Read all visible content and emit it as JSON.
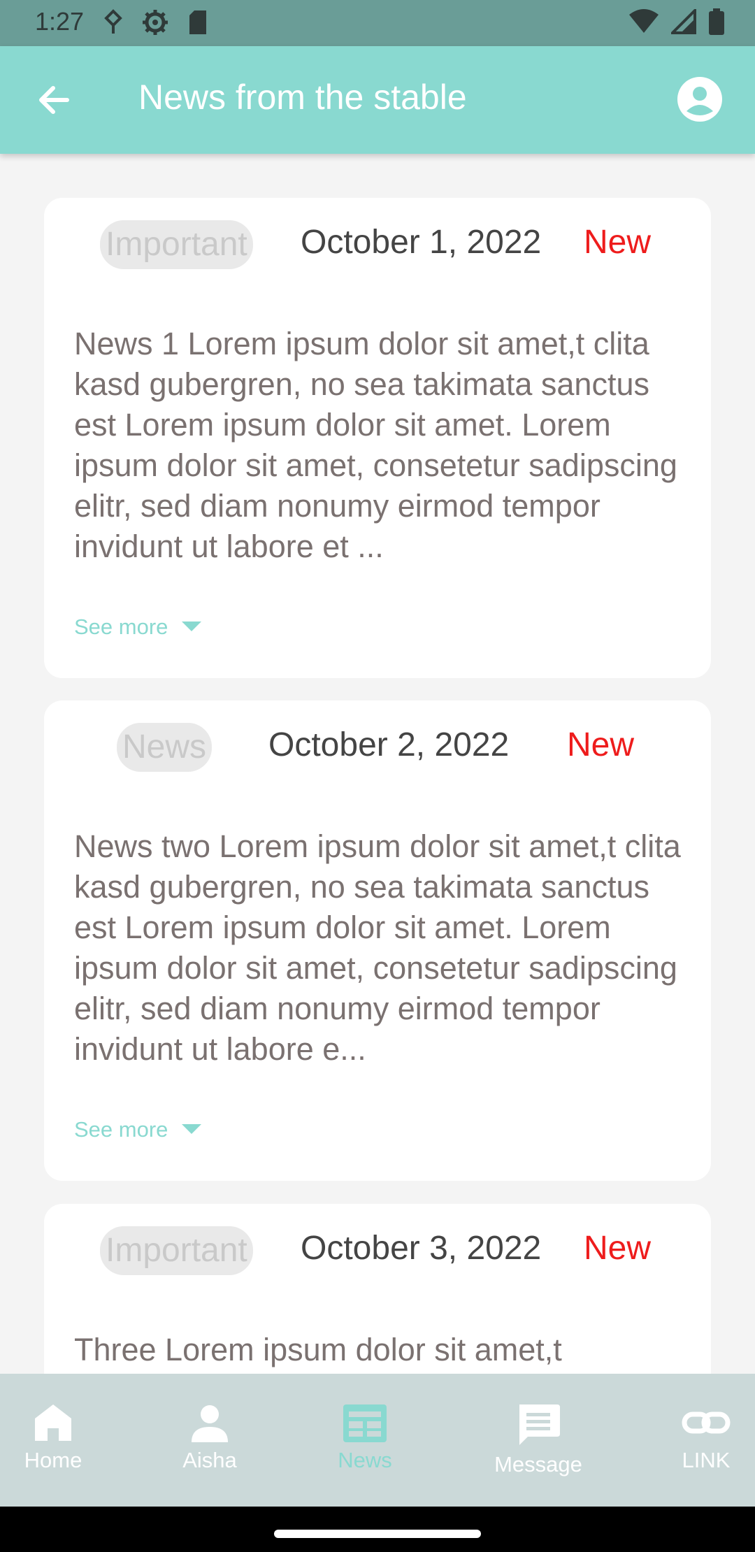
{
  "status_bar": {
    "time": "1:27",
    "left_icons": [
      "nearby-icon",
      "settings-gear-icon",
      "sd-card-icon"
    ],
    "right_icons": [
      "wifi-icon",
      "signal-icon",
      "battery-icon"
    ]
  },
  "app_bar": {
    "title": "News from the stable",
    "color": "#89d9d0",
    "back_icon": "arrow-back-icon",
    "account_icon": "account-circle-icon"
  },
  "news": [
    {
      "tag": "Important",
      "date": "October 1, 2022",
      "badge": "New",
      "text": "News 1 Lorem ipsum dolor sit amet,t clita kasd gubergren, no sea takimata sanctus est Lorem ipsum dolor sit amet. Lorem ipsum dolor sit amet, consetetur sadipscing elitr, sed diam nonumy eirmod tempor invidunt ut labore et ...",
      "see_more": "See more"
    },
    {
      "tag": "News",
      "date": "October 2, 2022",
      "badge": "New",
      "text": "News two Lorem ipsum dolor sit amet,t clita kasd gubergren, no sea takimata sanctus est Lorem ipsum dolor sit amet. Lorem ipsum dolor sit amet, consetetur sadipscing elitr, sed diam nonumy eirmod tempor invidunt ut labore e...",
      "see_more": "See more"
    },
    {
      "tag": "Important",
      "date": "October 3, 2022",
      "badge": "New",
      "text": "Three Lorem ipsum dolor sit amet,t",
      "see_more": ""
    }
  ],
  "bottom_nav": {
    "items": [
      {
        "label": "Home",
        "icon": "home-icon"
      },
      {
        "label": "Aisha",
        "icon": "person-icon"
      },
      {
        "label": "News",
        "icon": "newspaper-icon",
        "active": true
      },
      {
        "label": "Message",
        "icon": "message-icon"
      },
      {
        "label": "LINK",
        "icon": "link-icon"
      }
    ]
  },
  "colors": {
    "accent": "#89d9d0",
    "new_badge": "#ee1c1c",
    "tag_bg": "#e9e9e9",
    "nav_bg": "#cbd9d9"
  }
}
